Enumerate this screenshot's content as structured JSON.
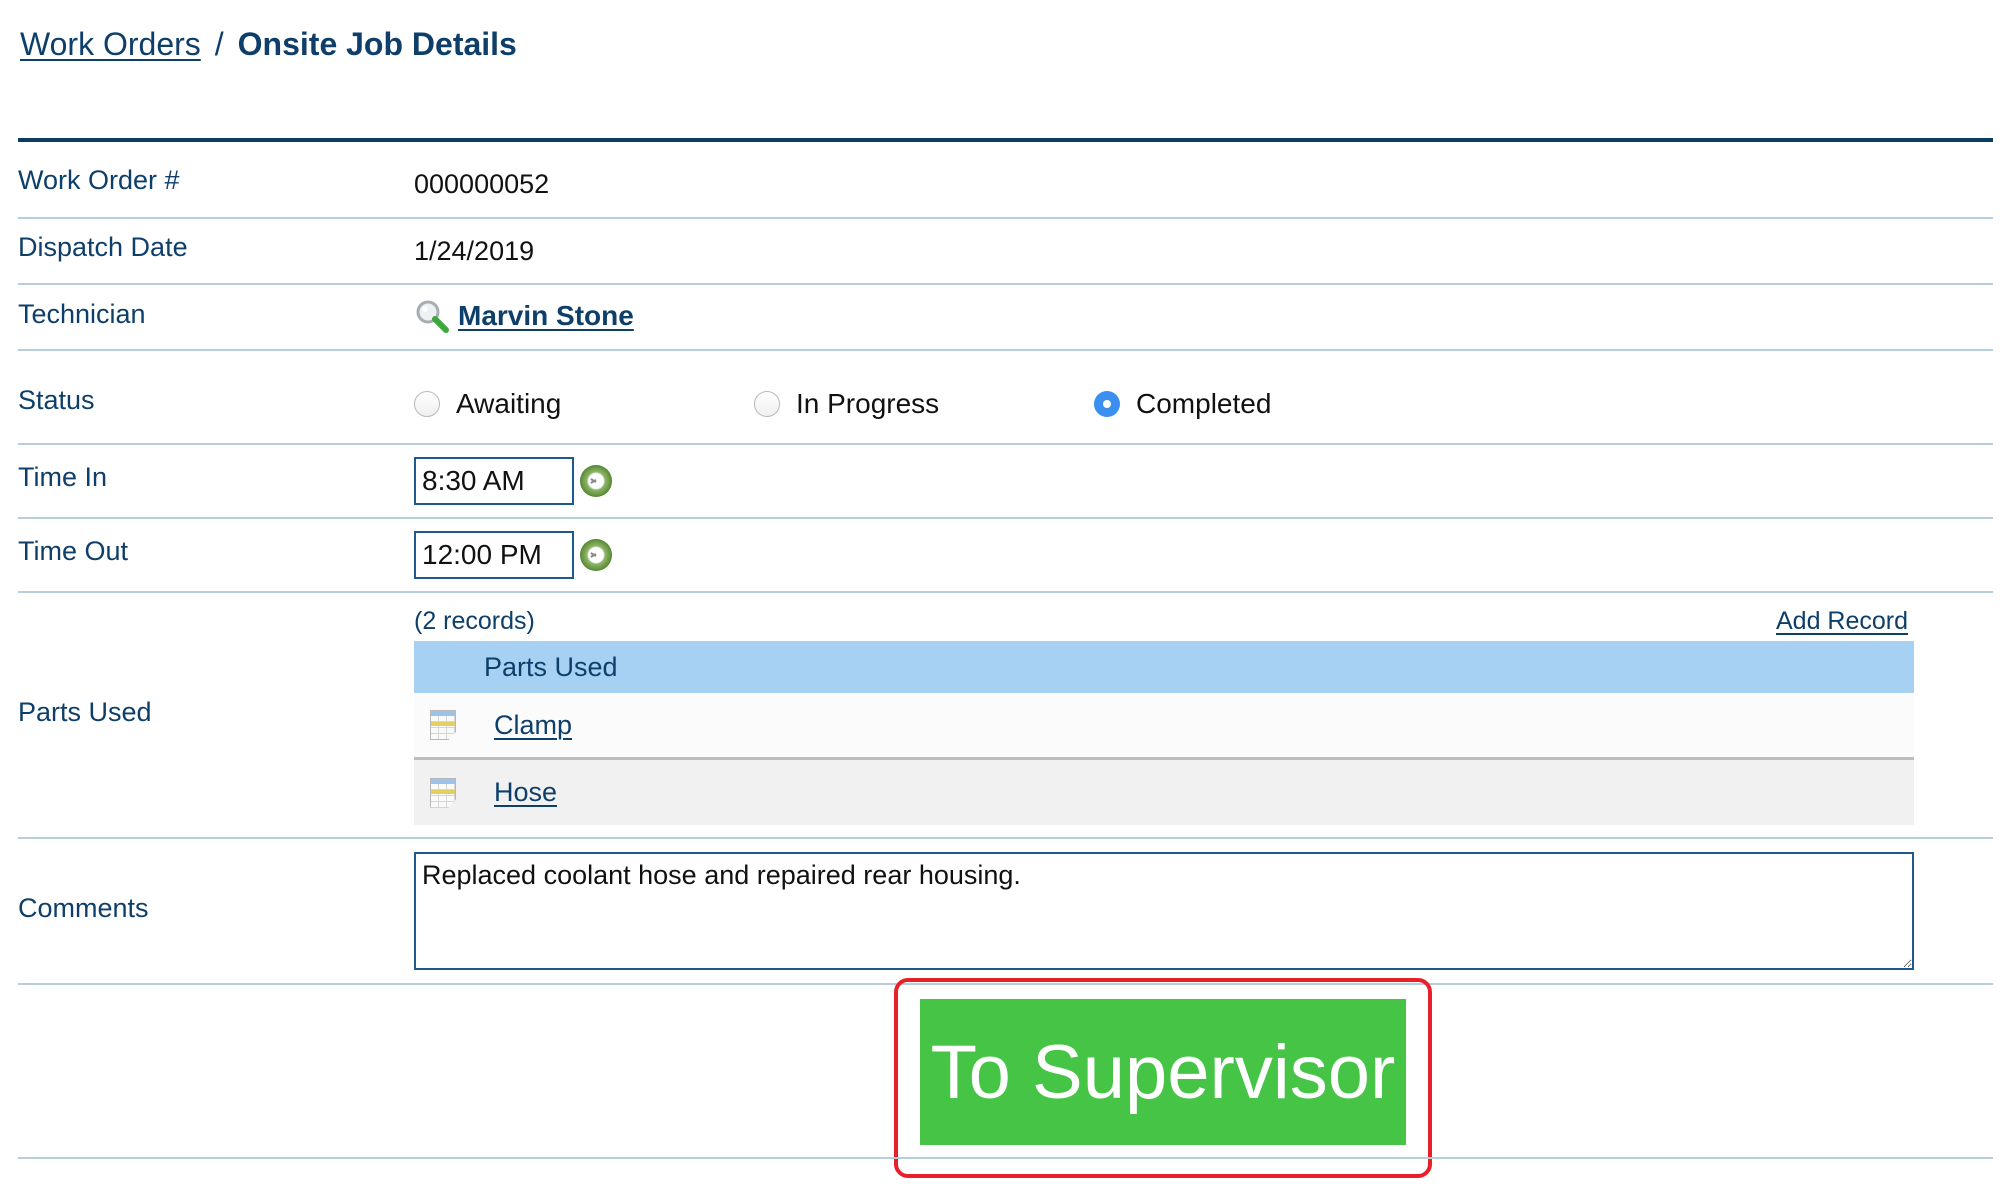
{
  "breadcrumb": {
    "parent": "Work Orders",
    "separator": "/",
    "current": "Onsite Job Details"
  },
  "fields": {
    "work_order": {
      "label": "Work Order #",
      "value": "000000052"
    },
    "dispatch_date": {
      "label": "Dispatch Date",
      "value": "1/24/2019"
    },
    "technician": {
      "label": "Technician",
      "value": "Marvin Stone",
      "icon": "search-icon"
    },
    "status": {
      "label": "Status",
      "options": [
        {
          "label": "Awaiting",
          "checked": false
        },
        {
          "label": "In Progress",
          "checked": false
        },
        {
          "label": "Completed",
          "checked": true
        }
      ],
      "selected": "Completed"
    },
    "time_in": {
      "label": "Time In",
      "value": "8:30 AM",
      "icon": "clock-icon"
    },
    "time_out": {
      "label": "Time Out",
      "value": "12:00 PM",
      "icon": "clock-icon"
    },
    "parts_used": {
      "label": "Parts Used",
      "record_count": "(2 records)",
      "add_record": "Add Record",
      "column_header": "Parts Used",
      "rows": [
        {
          "name": "Clamp",
          "icon": "record-icon"
        },
        {
          "name": "Hose",
          "icon": "record-icon"
        }
      ]
    },
    "comments": {
      "label": "Comments",
      "value": "Replaced coolant hose and repaired rear housing."
    }
  },
  "actions": {
    "to_supervisor": "To Supervisor"
  },
  "colors": {
    "text_navy": "#0e3f6a",
    "rule_top": "#0b3d63",
    "rule": "#b7cfdc",
    "table_header": "#a6d1f3",
    "button_green": "#46c446",
    "highlight_red": "#e8202a",
    "radio_checked": "#3b8ff0"
  }
}
